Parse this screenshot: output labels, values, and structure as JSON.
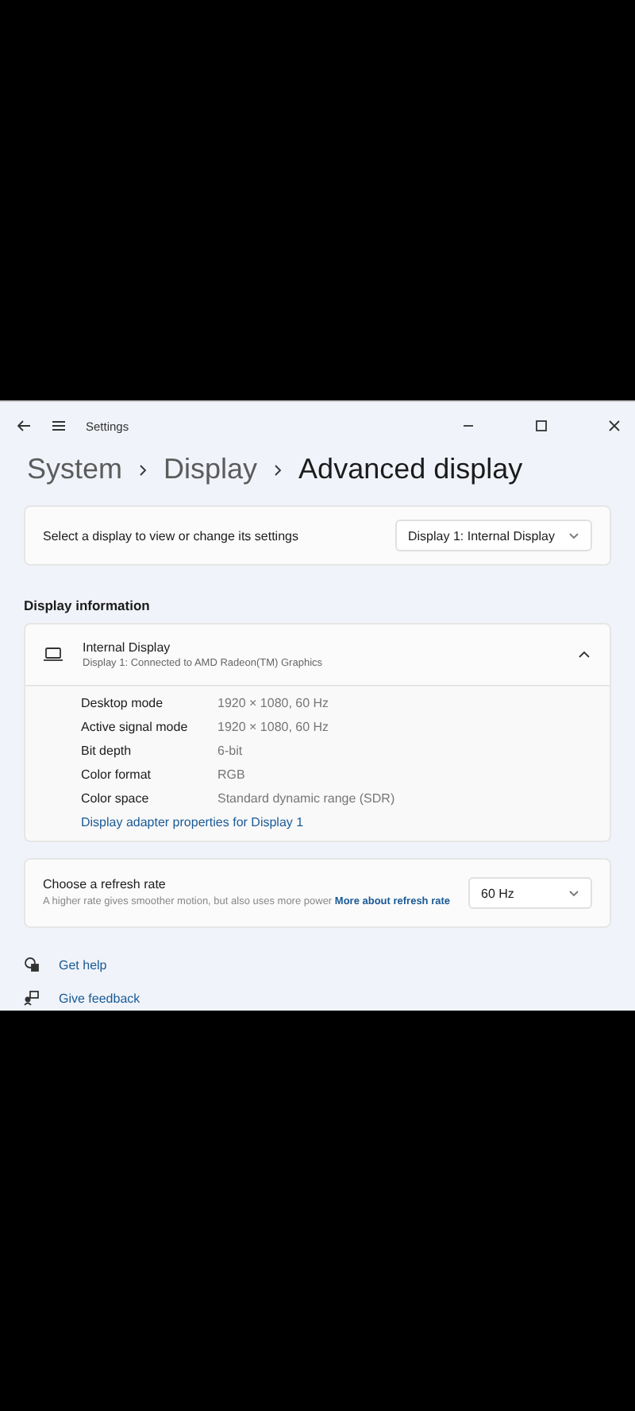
{
  "window": {
    "title": "Settings"
  },
  "breadcrumb": [
    {
      "label": "System",
      "current": false
    },
    {
      "label": "Display",
      "current": false
    },
    {
      "label": "Advanced display",
      "current": true
    }
  ],
  "display_selector": {
    "label": "Select a display to view or change its settings",
    "value": "Display 1: Internal Display"
  },
  "section_title": "Display information",
  "display_card": {
    "title": "Internal Display",
    "subtitle": "Display 1: Connected to AMD Radeon(TM) Graphics",
    "expanded": true,
    "rows": [
      {
        "label": "Desktop mode",
        "value": "1920 × 1080, 60 Hz"
      },
      {
        "label": "Active signal mode",
        "value": "1920 × 1080, 60 Hz"
      },
      {
        "label": "Bit depth",
        "value": "6-bit"
      },
      {
        "label": "Color format",
        "value": "RGB"
      },
      {
        "label": "Color space",
        "value": "Standard dynamic range (SDR)"
      }
    ],
    "link": "Display adapter properties for Display 1"
  },
  "refresh_rate": {
    "title": "Choose a refresh rate",
    "description": "A higher rate gives smoother motion, but also uses more power",
    "link": "More about refresh rate",
    "value": "60 Hz"
  },
  "footer_links": [
    {
      "kind": "help",
      "label": "Get help"
    },
    {
      "kind": "feedback",
      "label": "Give feedback"
    }
  ]
}
